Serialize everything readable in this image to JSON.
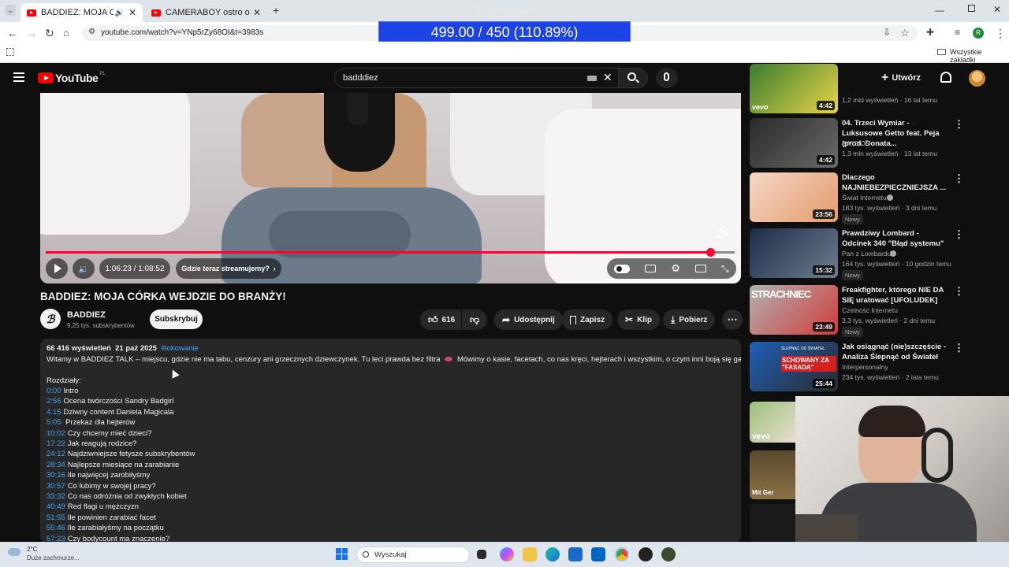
{
  "browser": {
    "tabs": [
      {
        "title": "BADDIEZ: MOJA CÓRKA WEJDZIE DO BRANŻY!",
        "active": true
      },
      {
        "title": "CAMERABOY ostro o NIKICIE i jego",
        "active": false
      }
    ],
    "new_tab_label": "+",
    "url": "youtube.com/watch?v=YNp5rZy68OI&t=3983s",
    "bookmarks_label": "Wszystkie zakładki",
    "profile_initial": "R"
  },
  "overlay": {
    "top_text": "z sympatii",
    "counter_text": "499.00 / 450 (110.89%)"
  },
  "youtube": {
    "logo_text": "YouTube",
    "logo_region": "PL",
    "search_value": "badddiez",
    "create_label": "Utwórz"
  },
  "player": {
    "time_text": "1:06:23 / 1:08:52",
    "progress": 0.964,
    "stream_chip": "Gdzie teraz streamujemy?"
  },
  "video": {
    "title": "BADDIEZ: MOJA CÓRKA WEJDZIE DO BRANŻY!",
    "channel": "BADDIEZ",
    "subscribers": "9,25 tys. subskrybentów",
    "subscribe_label": "Subskrybuj",
    "likes": "616",
    "share_label": "Udostępnij",
    "save_label": "Zapisz",
    "clip_label": "Klip",
    "download_label": "Pobierz"
  },
  "description": {
    "views": "66 416 wyświetleń",
    "date": "21 paź 2025",
    "hashtag": "#lokowanie",
    "intro_a": "Witamy w BADDIEZ TALK – miejscu, gdzie nie ma tabu, cenzury ani grzecznych dziewczynek. Tu leci prawda bez filtra",
    "intro_b": "Mówimy o kasie, facetach, co nas kręci, hejterach i wszystkim, o czym inni boją się gadać.",
    "chapters_label": "Rozdziały:",
    "chapters": [
      {
        "t": "0:00",
        "label": "Intro"
      },
      {
        "t": "2:56",
        "label": "Ocena twórczości Sandry Badgirl"
      },
      {
        "t": "4:15",
        "label": "Dziwny content Daniela Magicala"
      },
      {
        "t": "5:05",
        "label": " Przekaz dla hejterów"
      },
      {
        "t": "10:02",
        "label": "Czy chcemy mieć dzieci?"
      },
      {
        "t": "17:22",
        "label": "Jak reagują rodzice?"
      },
      {
        "t": "24:12",
        "label": "Najdziwniejsze fetysze subskrybentów"
      },
      {
        "t": "28:34",
        "label": "Najlepsze miesiące na zarabianie"
      },
      {
        "t": "30:16",
        "label": "Ile najwięcej zarobiłyśmy"
      },
      {
        "t": "30:57",
        "label": "Co lubimy w swojej pracy?"
      },
      {
        "t": "33:32",
        "label": "Co nas odróżnia od zwykłych kobiet"
      },
      {
        "t": "40:49",
        "label": "Red flagi u mężczyzn"
      },
      {
        "t": "51:55",
        "label": "Ile powinien zarabiać facet"
      },
      {
        "t": "55:46",
        "label": "Ile zarabiałyśmy na początku"
      },
      {
        "t": "57:23",
        "label": "Czy bodycount ma znaczenie?"
      }
    ]
  },
  "sidebar": [
    {
      "title": "",
      "channel": "",
      "meta": "1,2 mld wyświetleń · 16 lat temu",
      "duration": "4:42",
      "new": ""
    },
    {
      "title": "04. Trzeci Wymiar - Luksusowe Getto feat. Peja (prod. Donata...",
      "channel": "3WISION",
      "meta": "1,3 mln wyświetleń · 13 lat temu",
      "duration": "4:42",
      "new": ""
    },
    {
      "title": "Dlaczego NAJNIEBEZPIECZNIEJSZA ...",
      "channel": "Świat Internetu",
      "meta": "183 tys. wyświetleń · 3 dni temu",
      "duration": "23:56",
      "new": "Nowy"
    },
    {
      "title": "Prawdziwy Lombard - Odcinek 340 \"Błąd systemu\"",
      "channel": "Pan z Lombardu",
      "meta": "164 tys. wyświetleń · 10 godzin temu",
      "duration": "15:32",
      "new": "Nowy"
    },
    {
      "title": "Freakfighter, którego NIE DA SIĘ uratować [UFOLUDEK]",
      "channel": "Czelność Internetu",
      "meta": "3,3 tys. wyświetleń · 2 dni temu",
      "duration": "23:49",
      "new": "Nowy"
    },
    {
      "title": "Jak osiągnąć (nie)szczęście - Analiza Ślepnąć od Świateł",
      "channel": "Interpersonalny",
      "meta": "234 tys. wyświetleń · 2 lata temu",
      "duration": "25:44",
      "new": ""
    }
  ],
  "thumb_text": {
    "vevo": "vevo",
    "strach": "STRACHNIEC",
    "schowany_top": "ŚLEPNĄC OD ŚWIATEŁ:",
    "schowany": "SCHOWANY ZA \"FASADĄ\"",
    "mit": "Mit Ger"
  },
  "taskbar": {
    "weather_temp": "2°C",
    "weather_desc": "Duże zachmurze...",
    "search_placeholder": "Wyszukaj"
  },
  "colors": {
    "yt_red": "#ff0000",
    "progress_red": "#ff0033",
    "link_blue": "#3ea6ff",
    "overlay_blue": "#1d43e6"
  }
}
